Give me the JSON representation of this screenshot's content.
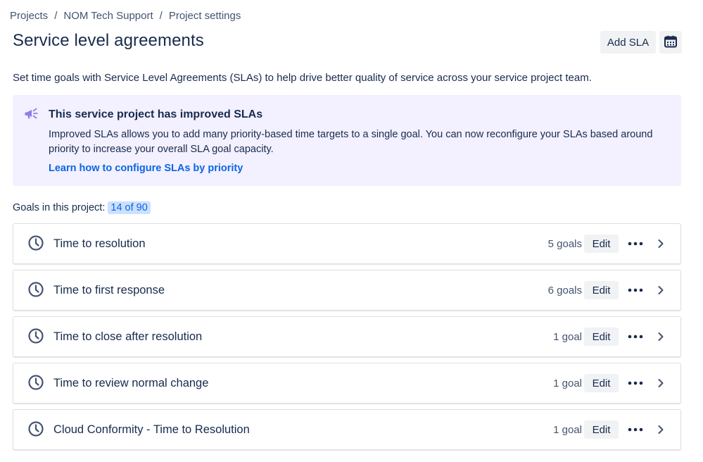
{
  "breadcrumb": {
    "items": [
      "Projects",
      "NOM Tech Support",
      "Project settings"
    ],
    "separator": "/"
  },
  "page": {
    "title": "Service level agreements",
    "add_button": "Add SLA",
    "calendar_icon": "calendar-icon",
    "intro": "Set time goals with Service Level Agreements (SLAs) to help drive better quality of service across your service project team."
  },
  "banner": {
    "icon": "megaphone-icon",
    "title": "This service project has improved SLAs",
    "body": "Improved SLAs allows you to add many priority-based time targets to a single goal. You can now reconfigure your SLAs based around priority to increase your overall SLA goal capacity.",
    "link": "Learn how to configure SLAs by priority",
    "accent_color": "#8f7ee7",
    "background": "#f3f0ff"
  },
  "goals": {
    "label": "Goals in this project:",
    "count": "14 of 90"
  },
  "slas": [
    {
      "name": "Time to resolution",
      "goals": "5 goals",
      "edit": "Edit"
    },
    {
      "name": "Time to first response",
      "goals": "6 goals",
      "edit": "Edit"
    },
    {
      "name": "Time to close after resolution",
      "goals": "1 goal",
      "edit": "Edit"
    },
    {
      "name": "Time to review normal change",
      "goals": "1 goal",
      "edit": "Edit"
    },
    {
      "name": "Cloud Conformity - Time to Resolution",
      "goals": "1 goal",
      "edit": "Edit"
    }
  ],
  "colors": {
    "link": "#0c66e4",
    "text": "#172b4d",
    "subtle": "#44546f"
  }
}
